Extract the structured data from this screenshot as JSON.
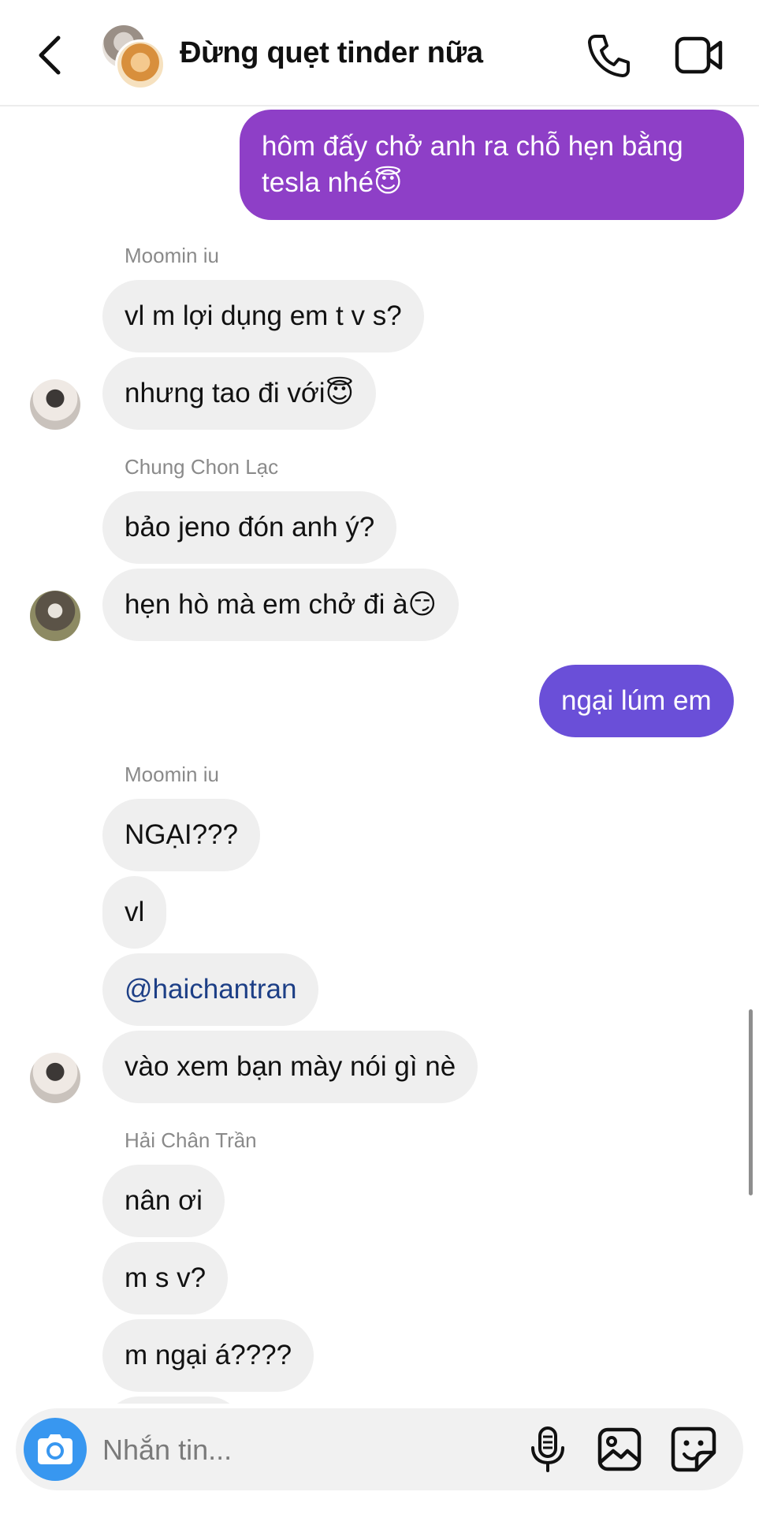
{
  "header": {
    "title": "Đừng quẹt tinder nữa",
    "icons": [
      "back-icon",
      "phone-icon",
      "video-camera-icon"
    ]
  },
  "thread": {
    "m1": {
      "text": "hôm đấy chở anh ra chỗ hẹn bằng",
      "text2": "tesla nhé😇"
    },
    "sender1": "Moomin iu",
    "m2": "vl m lợi dụng em t v s?",
    "m3": "nhưng tao đi với😇",
    "sender2": "Chung Chon Lạc",
    "m4": "bảo jeno đón anh ý?",
    "m5": "hẹn hò mà em chở đi à😏",
    "m6": "ngại lúm em",
    "sender3": "Moomin iu",
    "m7": "NGẠI???",
    "m8": "vl",
    "m9": "@haichantran",
    "m10": "vào xem bạn mày nói gì nè",
    "sender4": "Hải Chân Trần",
    "m11": "nân ơi",
    "m12": "m s v?",
    "m13": "m ngại á????"
  },
  "composer": {
    "placeholder": "Nhắn tin...",
    "icons": [
      "camera-icon",
      "microphone-icon",
      "image-icon",
      "sticker-icon"
    ]
  },
  "colors": {
    "outgoing_top": "#8e3fc7",
    "outgoing_bottom": "#6a4fd8",
    "incoming": "#efefef",
    "camera_button": "#3897f0",
    "mention": "#1d3f86"
  }
}
